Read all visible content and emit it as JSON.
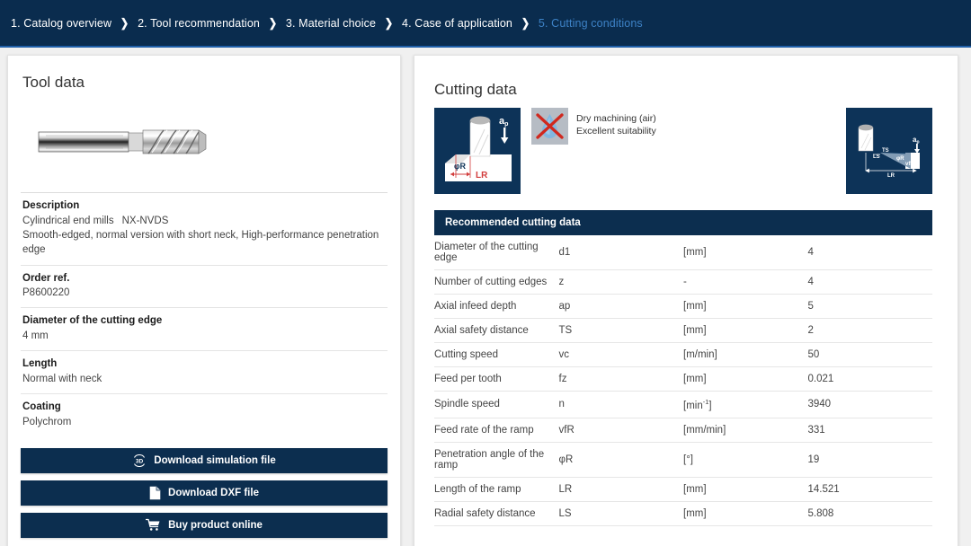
{
  "breadcrumb": {
    "separator": "›",
    "items": [
      {
        "label": "1. Catalog overview",
        "active": false
      },
      {
        "label": "2. Tool recommendation",
        "active": false
      },
      {
        "label": "3. Material choice",
        "active": false
      },
      {
        "label": "4. Case of application",
        "active": false
      },
      {
        "label": "5. Cutting conditions",
        "active": true
      }
    ]
  },
  "colors": {
    "header_navy": "#0a2c4e",
    "accent_blue": "#3d82c6",
    "table_header": "#0c2e4f",
    "button_navy": "#0c2e4f",
    "page_background": "#f0f0f0"
  },
  "tool_panel": {
    "title": "Tool data",
    "tool_image_name": "cylindrical-end-mill-photo",
    "specs": [
      {
        "label": "Description",
        "value_line1_a": "Cylindrical end mills",
        "value_line1_b": "NX-NVDS",
        "value_line2": "Smooth-edged, normal version with short neck, High-performance penetration edge"
      },
      {
        "label": "Order ref.",
        "value": "P8600220"
      },
      {
        "label": "Diameter of the cutting edge",
        "value": "4 mm"
      },
      {
        "label": "Length",
        "value": "Normal with neck"
      },
      {
        "label": "Coating",
        "value": "Polychrom"
      }
    ],
    "buttons": [
      {
        "label": "Download simulation file",
        "icon": "3d-icon"
      },
      {
        "label": "Download DXF file",
        "icon": "document-icon"
      },
      {
        "label": "Buy product online",
        "icon": "shopping-cart-icon"
      }
    ]
  },
  "cutting_panel": {
    "title": "Cutting data",
    "ramp_diagram_left": {
      "name": "ramp-penetration-diagram",
      "labels": [
        "ap",
        "φR",
        "LR"
      ]
    },
    "ramp_diagram_right": {
      "name": "ramp-geometry-diagram",
      "labels": [
        "ap",
        "TS",
        "LS",
        "LR",
        "φR",
        "vfR"
      ]
    },
    "coolant": {
      "icon": "dry-machining-no-coolant-icon",
      "line1": "Dry machining (air)",
      "line2": "Excellent suitability"
    },
    "table": {
      "header": "Recommended cutting data",
      "rows": [
        {
          "name": "Diameter of the cutting edge",
          "symbol": "d1",
          "unit": "[mm]",
          "value": "4"
        },
        {
          "name": "Number of cutting edges",
          "symbol": "z",
          "unit": "-",
          "value": "4"
        },
        {
          "name": "Axial infeed depth",
          "symbol": "ap",
          "unit": "[mm]",
          "value": "5"
        },
        {
          "name": "Axial safety distance",
          "symbol": "TS",
          "unit": "[mm]",
          "value": "2"
        },
        {
          "name": "Cutting speed",
          "symbol": "vc",
          "unit": "[m/min]",
          "value": "50"
        },
        {
          "name": "Feed per tooth",
          "symbol": "fz",
          "unit": "[mm]",
          "value": "0.021"
        },
        {
          "name": "Spindle speed",
          "symbol": "n",
          "unit": "[min-1]",
          "unit_html": true,
          "value": "3940"
        },
        {
          "name": "Feed rate of the ramp",
          "symbol": "vfR",
          "unit": "[mm/min]",
          "value": "331"
        },
        {
          "name": "Penetration angle of the ramp",
          "symbol": "φR",
          "unit": "[°]",
          "value": "19"
        },
        {
          "name": "Length of the ramp",
          "symbol": "LR",
          "unit": "[mm]",
          "value": "14.521"
        },
        {
          "name": "Radial safety distance",
          "symbol": "LS",
          "unit": "[mm]",
          "value": "5.808"
        }
      ]
    }
  }
}
